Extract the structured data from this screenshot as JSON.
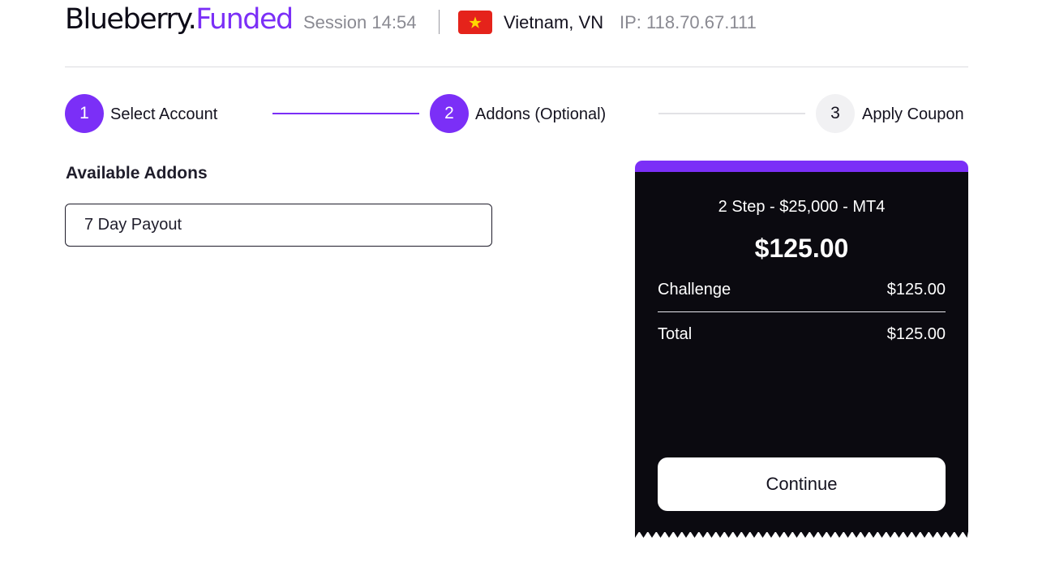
{
  "header": {
    "logo_primary": "Blueberry.",
    "logo_accent": "Funded",
    "session": "Session 14:54",
    "country": "Vietnam, VN",
    "ip": "IP: 118.70.67.111",
    "flag_icon": "vietnam-flag-icon"
  },
  "steps": [
    {
      "number": "1",
      "label": "Select Account",
      "state": "done"
    },
    {
      "number": "2",
      "label": "Addons (Optional)",
      "state": "active"
    },
    {
      "number": "3",
      "label": "Apply Coupon",
      "state": "pending"
    }
  ],
  "addons": {
    "title": "Available Addons",
    "items": [
      "7 Day Payout"
    ]
  },
  "summary": {
    "product": "2 Step - $25,000 - MT4",
    "price": "$125.00",
    "rows": [
      {
        "label": "Challenge",
        "value": "$125.00"
      },
      {
        "label": "Total",
        "value": "$125.00"
      }
    ],
    "continue_label": "Continue"
  },
  "colors": {
    "accent": "#7b2ff7",
    "panel": "#0b0a10",
    "flag_red": "#e5231b",
    "flag_star": "#ffd800"
  }
}
